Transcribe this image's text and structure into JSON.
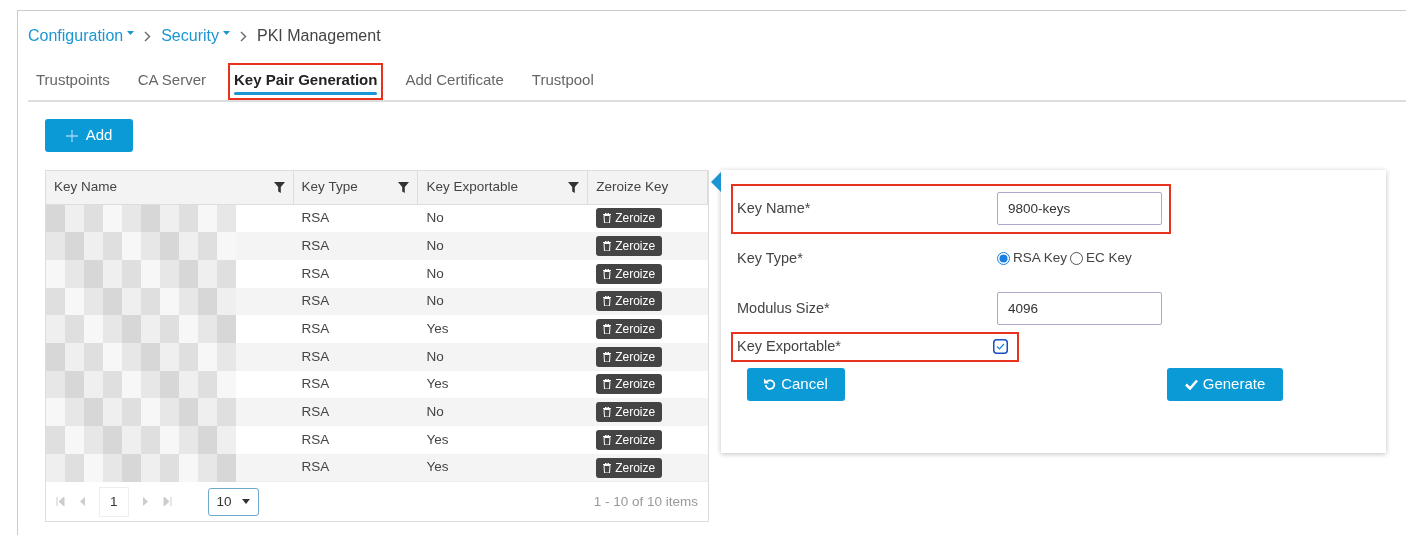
{
  "breadcrumb": [
    {
      "label": "Configuration",
      "kind": "dropdown"
    },
    {
      "label": "Security",
      "kind": "dropdown"
    },
    {
      "label": "PKI Management",
      "kind": "current"
    }
  ],
  "tabs": [
    {
      "label": "Trustpoints",
      "selected": false,
      "highlighted": false
    },
    {
      "label": "CA Server",
      "selected": false,
      "highlighted": false
    },
    {
      "label": "Key Pair Generation",
      "selected": true,
      "highlighted": true
    },
    {
      "label": "Add Certificate",
      "selected": false,
      "highlighted": false
    },
    {
      "label": "Trustpool",
      "selected": false,
      "highlighted": false
    }
  ],
  "add_button": "Add",
  "table": {
    "columns": [
      {
        "label": "Key Name",
        "filter": true
      },
      {
        "label": "Key Type",
        "filter": true
      },
      {
        "label": "Key Exportable",
        "filter": true
      },
      {
        "label": "Zeroize Key",
        "filter": false
      }
    ],
    "rows": [
      {
        "key_type": "RSA",
        "exportable": "No",
        "action": "Zeroize"
      },
      {
        "key_type": "RSA",
        "exportable": "No",
        "action": "Zeroize"
      },
      {
        "key_type": "RSA",
        "exportable": "No",
        "action": "Zeroize"
      },
      {
        "key_type": "RSA",
        "exportable": "No",
        "action": "Zeroize"
      },
      {
        "key_type": "RSA",
        "exportable": "Yes",
        "action": "Zeroize"
      },
      {
        "key_type": "RSA",
        "exportable": "No",
        "action": "Zeroize"
      },
      {
        "key_type": "RSA",
        "exportable": "Yes",
        "action": "Zeroize"
      },
      {
        "key_type": "RSA",
        "exportable": "No",
        "action": "Zeroize"
      },
      {
        "key_type": "RSA",
        "exportable": "Yes",
        "action": "Zeroize"
      },
      {
        "key_type": "RSA",
        "exportable": "Yes",
        "action": "Zeroize"
      }
    ],
    "pager": {
      "page": "1",
      "page_size": "10",
      "summary": "1 - 10 of 10 items"
    }
  },
  "form": {
    "fields": [
      {
        "kind": "text",
        "label": "Key Name*",
        "value": "9800-keys",
        "highlighted": true
      },
      {
        "kind": "radio",
        "label": "Key Type*",
        "highlighted": false,
        "options": [
          {
            "label": "RSA Key",
            "selected": true
          },
          {
            "label": "EC Key",
            "selected": false
          }
        ]
      },
      {
        "kind": "text",
        "label": "Modulus Size*",
        "value": "4096",
        "highlighted": false
      },
      {
        "kind": "checkbox",
        "label": "Key Exportable*",
        "checked": true,
        "highlighted": true
      }
    ],
    "cancel": "Cancel",
    "generate": "Generate"
  }
}
